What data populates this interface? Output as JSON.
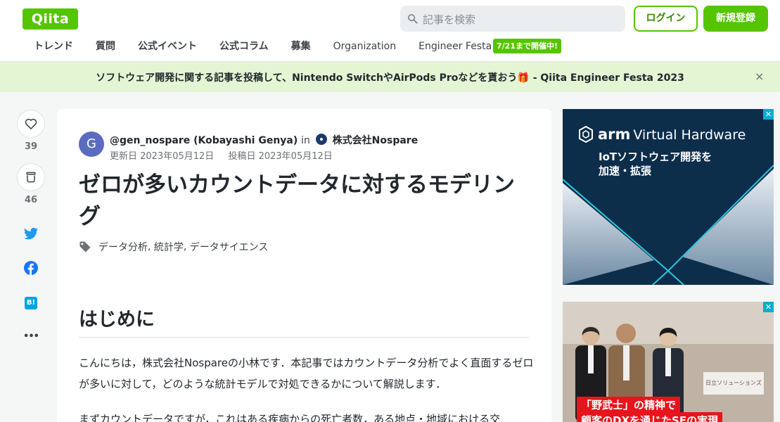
{
  "header": {
    "logo": "Qiita",
    "search_placeholder": "記事を検索",
    "login_label": "ログイン",
    "signup_label": "新規登録"
  },
  "nav": {
    "items": [
      "トレンド",
      "質問",
      "公式イベント",
      "公式コラム",
      "募集",
      "Organization",
      "Engineer Festa"
    ],
    "festa_badge": "7/21まで開催中!"
  },
  "banner": {
    "text": "ソフトウェア開発に関する記事を投稿して、Nintendo SwitchやAirPods Proなどを貰おう🎁 - Qiita Engineer Festa 2023",
    "close": "×"
  },
  "sidebar": {
    "like_count": "39",
    "stock_count": "46",
    "more": "•••",
    "hatena_label": "B!"
  },
  "article": {
    "avatar_letter": "G",
    "author": "@gen_nospare (Kobayashi Genya)",
    "in_label": "in",
    "organization": "株式会社Nospare",
    "updated": "更新日 2023年05月12日",
    "posted": "投稿日 2023年05月12日",
    "title": "ゼロが多いカウントデータに対するモデリング",
    "tags": [
      "データ分析",
      "統計学",
      "データサイエンス"
    ],
    "heading": "はじめに",
    "para1": "こんにちは，株式会社Nospareの小林です．本記事ではカウントデータ分析でよく直面するゼロが多いに対して，どのような統計モデルで対処できるかについて解説します．",
    "para2": "まずカウントデータですが，これはある疾病からの死亡者数，ある地点・地域における交"
  },
  "ads": {
    "arm_brand": "arm",
    "arm_product": "Virtual Hardware",
    "arm_line1": "IoTソフトウェア開発を",
    "arm_line2": "加速・拡張",
    "ad_close": "✕",
    "ad2_sign": "日立ソリューションズ",
    "ad2_catch1": "「野武士」の精神で",
    "ad2_catch2": "顧客のDXを通じたSEの実現"
  },
  "colors": {
    "brand": "#55c500",
    "banner_bg": "#e3f5d3",
    "twitter": "#1d9bf0",
    "facebook": "#1877f2",
    "hatena": "#00a4de"
  }
}
